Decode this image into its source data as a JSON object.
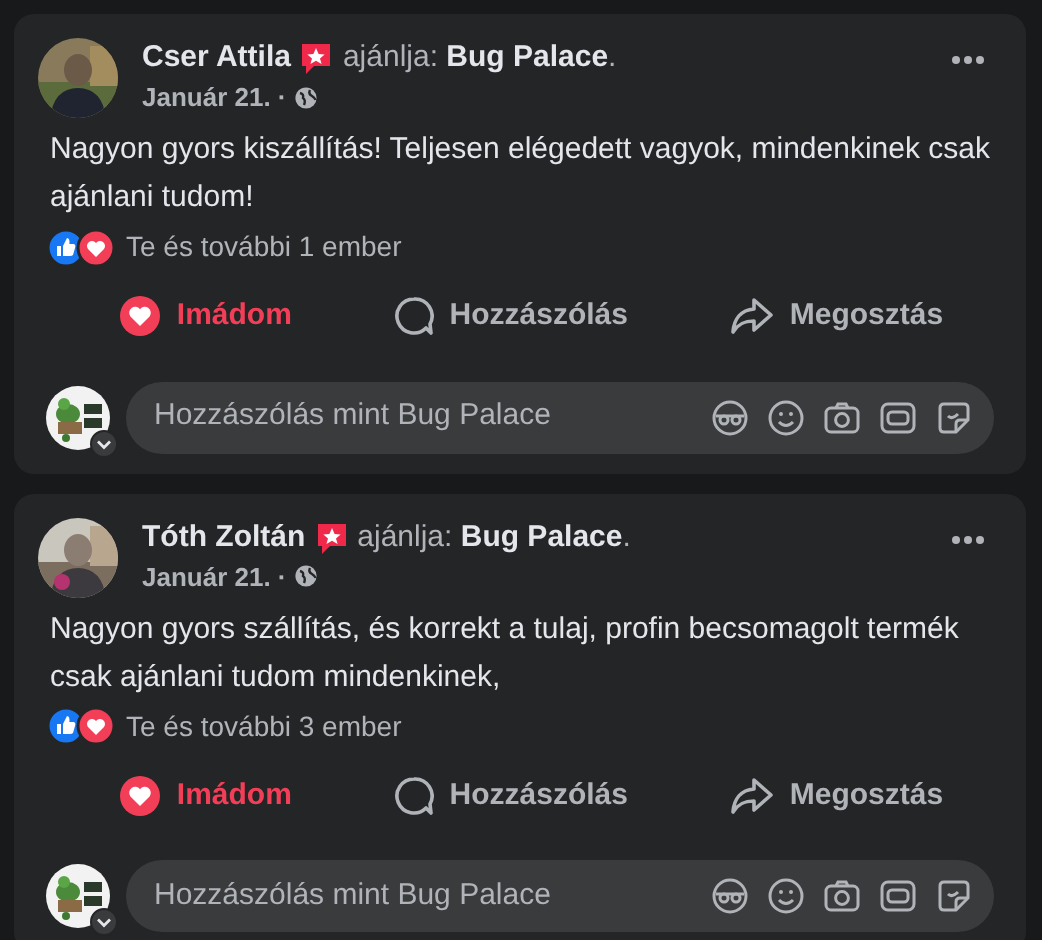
{
  "posts": [
    {
      "author": "Cser Attila",
      "recommendation": "ajánlja: **Bug Palace**.",
      "date": "Január 21. ·",
      "text": "Nagyon gyors kiszállítás! Teljesen elégedett vagyok, mindenkinek csak ajánlani tudom!",
      "reaction_summary": "Te és további 1 ember",
      "actions": [
        {
          "label": "Imádom",
          "kind": "love",
          "selected": true
        },
        {
          "label": "Hozzászólás",
          "kind": "comment",
          "selected": false
        },
        {
          "label": "Megosztás",
          "kind": "share",
          "selected": false
        }
      ],
      "comment_box": {
        "placeholder": "Hozzászólás mint Bug Palace"
      }
    },
    {
      "author": "Tóth Zoltán",
      "recommendation": "ajánlja: **Bug Palace**.",
      "date": "Január 21. ·",
      "text": "Nagyon gyors szállítás, és korrekt a tulaj, profin becsomagolt termék csak ajánlani tudom mindenkinek,",
      "reaction_summary": "Te és további 3 ember",
      "actions": [
        {
          "label": "Imádom",
          "kind": "love",
          "selected": true
        },
        {
          "label": "Hozzászólás",
          "kind": "comment",
          "selected": false
        },
        {
          "label": "Megosztás",
          "kind": "share",
          "selected": false
        }
      ],
      "comment_box": {
        "placeholder": "Hozzászólás mint Bug Palace"
      }
    }
  ]
}
